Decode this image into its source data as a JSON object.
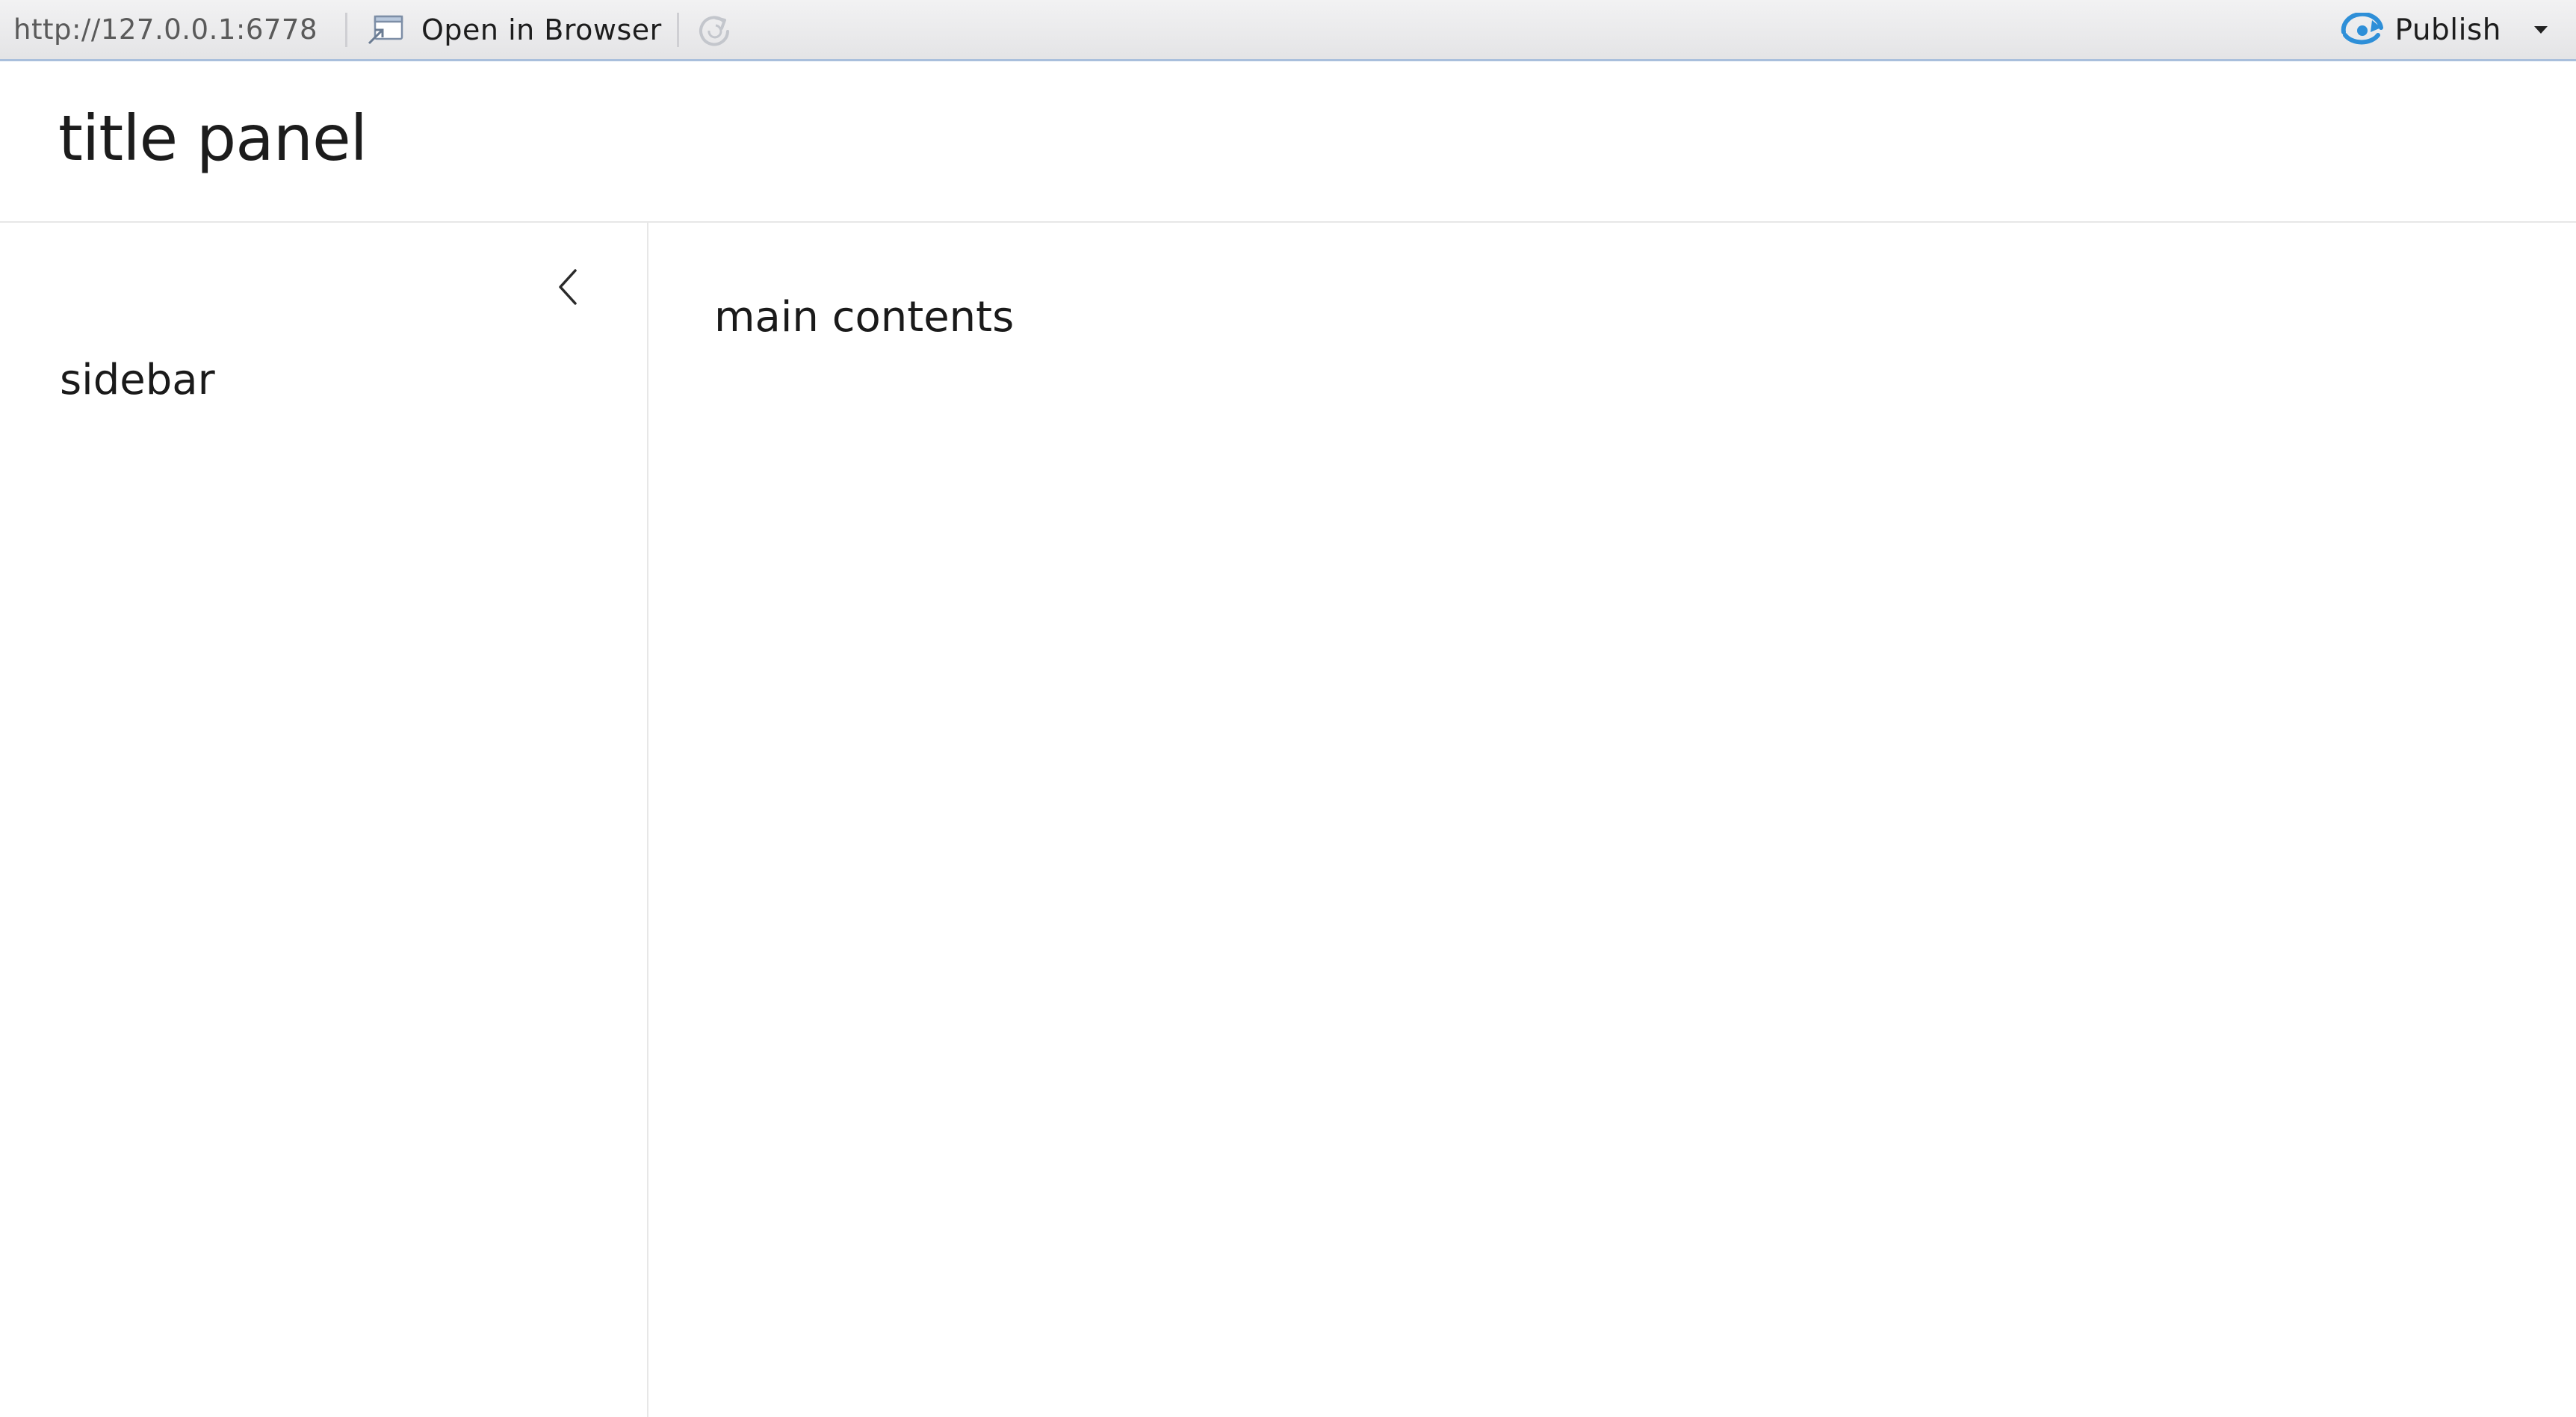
{
  "toolbar": {
    "url": "http://127.0.0.1:6778",
    "open_in_browser_label": "Open in Browser",
    "open_in_browser_icon": "open-in-browser-icon",
    "refresh_icon": "refresh-icon",
    "publish_label": "Publish",
    "publish_icon": "publish-icon",
    "publish_menu_icon": "caret-down-icon"
  },
  "header": {
    "title": "title panel"
  },
  "sidebar": {
    "collapse_icon": "chevron-left-icon",
    "text": "sidebar"
  },
  "main": {
    "text": "main contents"
  },
  "colors": {
    "publish_accent": "#2e8fd8",
    "toolbar_border": "#a9bfdc",
    "divider": "#e7e7e7"
  }
}
